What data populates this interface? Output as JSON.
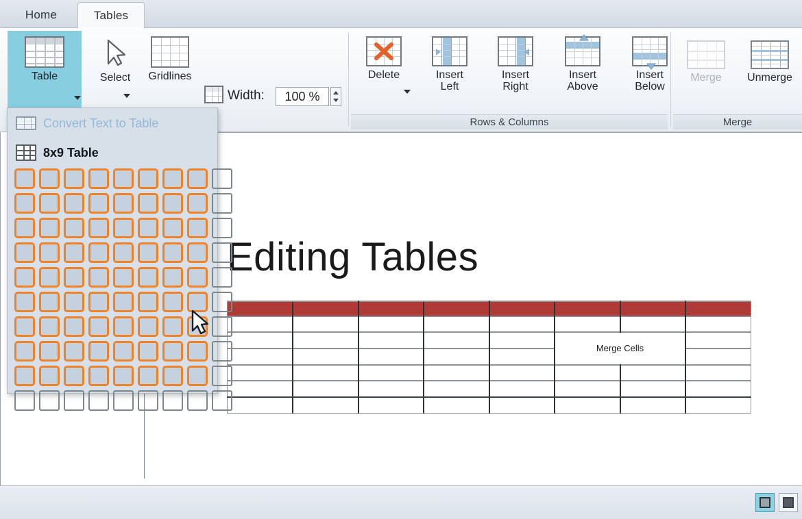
{
  "window": {
    "active_tab": "Tables"
  },
  "tabs": [
    {
      "label": "Home",
      "active": false
    },
    {
      "label": "Tables",
      "active": true
    }
  ],
  "ribbon": {
    "groups": [
      {
        "name": "table-options",
        "caption": "",
        "buttons": [
          {
            "label": "Table",
            "icon": "table-icon",
            "selected": true,
            "has_caret": true,
            "disabled": false
          },
          {
            "label": "Select",
            "icon": "cursor-arrow-icon",
            "selected": false,
            "has_caret": true,
            "disabled": false
          },
          {
            "label": "Gridlines",
            "icon": "gridlines-icon",
            "selected": false,
            "has_caret": false,
            "disabled": false
          }
        ],
        "width_control": {
          "icon": "table-width-icon",
          "label": "Width:",
          "value": "100 %",
          "spinner": "up-down-spinner"
        }
      },
      {
        "name": "rows-and-columns",
        "caption": "Rows & Columns",
        "buttons": [
          {
            "label": "Delete",
            "icon": "delete-table-icon",
            "has_caret": true,
            "disabled": false
          },
          {
            "label": "Insert\nLeft",
            "label_line1": "Insert",
            "label_line2": "Left",
            "icon": "insert-left-icon",
            "has_caret": false,
            "disabled": false
          },
          {
            "label_line1": "Insert",
            "label_line2": "Right",
            "icon": "insert-right-icon",
            "has_caret": false,
            "disabled": false
          },
          {
            "label_line1": "Insert",
            "label_line2": "Above",
            "icon": "insert-above-icon",
            "has_caret": false,
            "disabled": false
          },
          {
            "label_line1": "Insert",
            "label_line2": "Below",
            "icon": "insert-below-icon",
            "has_caret": false,
            "disabled": false
          }
        ]
      },
      {
        "name": "merge",
        "caption": "Merge",
        "buttons": [
          {
            "label": "Merge",
            "icon": "merge-cells-icon",
            "disabled": true
          },
          {
            "label": "Unmerge",
            "icon": "unmerge-cells-icon",
            "disabled": false
          }
        ]
      }
    ]
  },
  "table_popup": {
    "convert_label": "Convert Text to Table",
    "convert_icon": "convert-text-to-table-icon",
    "convert_disabled": true,
    "size_label": "8x9 Table",
    "size_icon": "table-grid-icon",
    "grid": {
      "selected_cols": 8,
      "selected_rows": 9,
      "total_cols": 9,
      "total_rows": 10
    },
    "cursor": "mouse-pointer"
  },
  "document": {
    "title": "Editing Tables",
    "table": {
      "columns": 8,
      "rows": 7,
      "header_fill": "#b03a35",
      "merged_cell_text": "Merge Cells"
    }
  },
  "status_bar": {
    "view_buttons": [
      {
        "name": "normal-view",
        "active": true
      },
      {
        "name": "slide-view",
        "active": false
      }
    ]
  },
  "colors": {
    "accent_selection": "#86cee0",
    "grid_highlight": "#ef8127",
    "table_header_red": "#b03a35",
    "disabled_text": "#aab2bb"
  }
}
